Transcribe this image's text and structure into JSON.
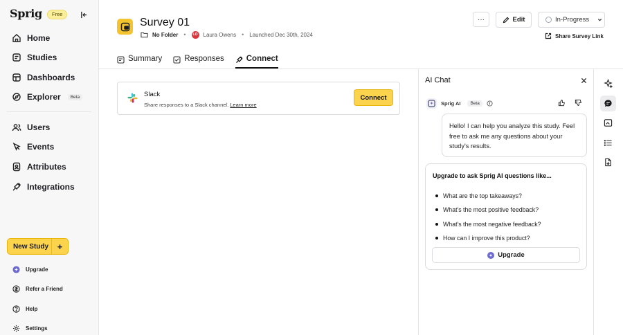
{
  "app": {
    "logo_text": "Sprig",
    "plan_badge": "Free"
  },
  "sidebar": {
    "nav_top": [
      {
        "label": "Home",
        "icon": "home-icon"
      },
      {
        "label": "Studies",
        "icon": "studies-icon"
      },
      {
        "label": "Dashboards",
        "icon": "dashboards-icon"
      },
      {
        "label": "Explorer",
        "icon": "explorer-icon",
        "badge": "Beta"
      }
    ],
    "nav_mid": [
      {
        "label": "Users",
        "icon": "users-icon"
      },
      {
        "label": "Events",
        "icon": "events-icon"
      },
      {
        "label": "Attributes",
        "icon": "attributes-icon"
      },
      {
        "label": "Integrations",
        "icon": "integrations-icon"
      }
    ],
    "new_study_label": "New Study",
    "new_study_plus": "+",
    "bottom": [
      {
        "label": "Upgrade",
        "icon": "upgrade-icon"
      },
      {
        "label": "Refer a Friend",
        "icon": "refer-icon"
      },
      {
        "label": "Help",
        "icon": "help-icon"
      },
      {
        "label": "Settings",
        "icon": "settings-icon"
      }
    ]
  },
  "header": {
    "title": "Survey 01",
    "folder": "No Folder",
    "avatar_initials": "LO",
    "owner": "Laura Owens",
    "launched": "Launched Dec 30th, 2024",
    "more_label": "···",
    "edit_label": "Edit",
    "status_label": "In-Progress",
    "share_label": "Share Survey Link"
  },
  "tabs": [
    {
      "label": "Summary",
      "icon": "summary-icon",
      "active": false
    },
    {
      "label": "Responses",
      "icon": "responses-icon",
      "active": false
    },
    {
      "label": "Connect",
      "icon": "connect-icon",
      "active": true
    }
  ],
  "integration": {
    "name": "Slack",
    "description": "Share responses to a Slack channel.",
    "learn_more": "Learn more",
    "button": "Connect"
  },
  "chat": {
    "title": "AI Chat",
    "assistant_name": "Sprig AI",
    "assistant_badge": "Beta",
    "greeting": "Hello! I can help you analyze this study. Feel free to ask me any questions about your study's results.",
    "upgrade_title": "Upgrade to ask Sprig AI questions like...",
    "questions": [
      "What are the top takeaways?",
      "What's the most positive feedback?",
      "What's the most negative feedback?",
      "How can I improve this product?"
    ],
    "upgrade_button": "Upgrade"
  },
  "colors": {
    "accent_yellow": "#fcd34d",
    "badge_yellow": "#fcef9c",
    "avatar_red": "#d9363e",
    "ai_purple": "#6d6ad0"
  }
}
